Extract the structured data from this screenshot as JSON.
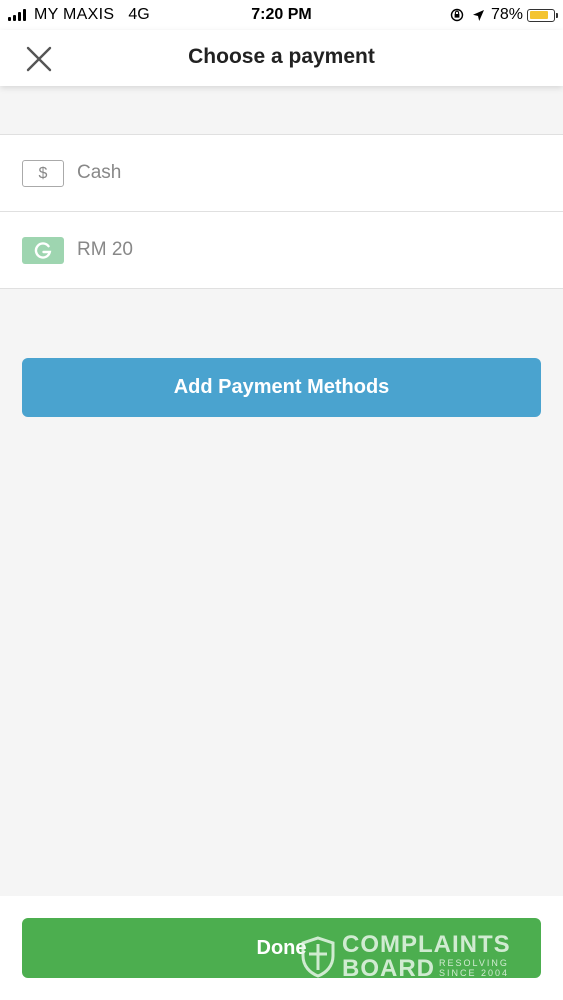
{
  "status_bar": {
    "carrier": "MY MAXIS",
    "network": "4G",
    "time": "7:20 PM",
    "battery_percent": "78%",
    "icons": [
      "signal-icon",
      "orientation-lock-icon",
      "location-arrow-icon",
      "battery-icon"
    ]
  },
  "header": {
    "title": "Choose a payment",
    "close_icon": "close-icon"
  },
  "payment_methods": [
    {
      "label": "Cash",
      "icon": "dollar-icon",
      "icon_glyph": "$"
    },
    {
      "label": "RM 20",
      "icon": "grabpay-icon",
      "icon_color": "#9ed5b0"
    }
  ],
  "add_button": {
    "label": "Add Payment Methods",
    "color": "#4aa3cf"
  },
  "done_button": {
    "label": "Done",
    "color": "#4cae4f"
  },
  "watermark": {
    "line1": "COMPLAINTS",
    "line2": "BOARD",
    "sub1": "RESOLVING",
    "sub2": "SINCE 2004"
  }
}
